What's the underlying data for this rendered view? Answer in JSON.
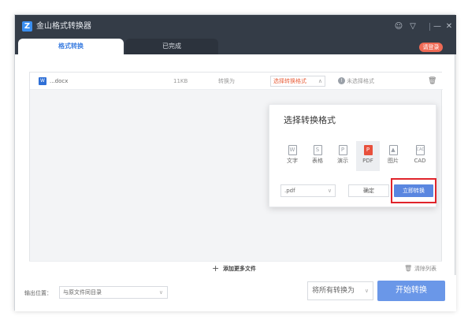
{
  "app": {
    "logo_glyph": "Z",
    "title": "金山格式转换器"
  },
  "titlebar": {
    "login_label": "请登录",
    "feedback_icon": "☺",
    "dropdown_icon": "▽",
    "minimize_icon": "—",
    "close_icon": "✕"
  },
  "tabs": [
    {
      "label": "格式转换",
      "active": true
    },
    {
      "label": "已完成",
      "active": false
    }
  ],
  "file_row": {
    "type_glyph": "W",
    "name": "...docx",
    "size": "11KB",
    "convert_to_label": "转换为",
    "format_select_label": "选择转换格式",
    "status_text": "未选择格式"
  },
  "format_popup": {
    "title": "选择转换格式",
    "formats": [
      {
        "label": "文字",
        "glyph": "W",
        "selected": false
      },
      {
        "label": "表格",
        "glyph": "S",
        "selected": false
      },
      {
        "label": "演示",
        "glyph": "P",
        "selected": false
      },
      {
        "label": "PDF",
        "glyph": "P",
        "selected": true
      },
      {
        "label": "图片",
        "glyph": "▲",
        "selected": false
      },
      {
        "label": "CAD",
        "glyph": "CAD",
        "selected": false
      }
    ],
    "extension_value": ".pdf",
    "ok_label": "确定",
    "convert_now_label": "立即转换"
  },
  "add_row": {
    "add_more_label": "添加更多文件",
    "clear_label": "清除列表"
  },
  "footer": {
    "output_label": "输出位置：",
    "output_value": "与原文件同目录",
    "all_convert_label": "将所有转换为",
    "start_label": "开始转换"
  },
  "colors": {
    "accent": "#5a86e0",
    "titlebar": "#343c47",
    "pdf_red": "#e8503c",
    "highlight": "#e0242b"
  }
}
